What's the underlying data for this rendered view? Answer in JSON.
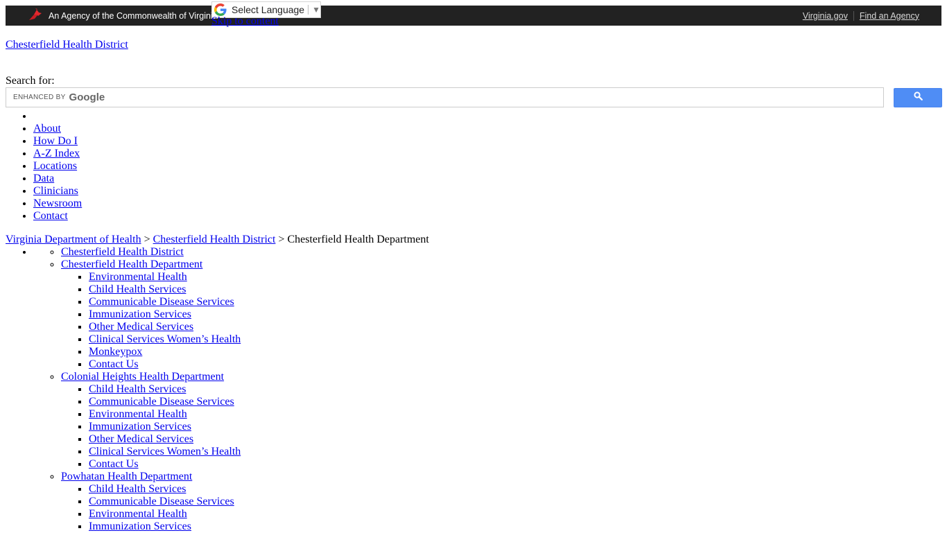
{
  "topbar": {
    "agency_text": "An Agency of the Commonwealth of Virginia",
    "links": [
      {
        "label": "Virginia.gov"
      },
      {
        "label": "Find an Agency"
      }
    ],
    "bg_color": "#222222",
    "logo_color": "#e5282e"
  },
  "translate": {
    "label": "Select Language",
    "arrow": "▼"
  },
  "skip_link": "Skip to content",
  "site_link": "Chesterfield Health District",
  "search": {
    "label": "Search for:",
    "enhanced_by": "ENHANCED BY",
    "google": "Google",
    "value": "",
    "button_color": "#4f8df5"
  },
  "nav": {
    "items": [
      {
        "label": ""
      },
      {
        "label": "About"
      },
      {
        "label": "How Do I"
      },
      {
        "label": "A-Z Index"
      },
      {
        "label": "Locations"
      },
      {
        "label": "Data"
      },
      {
        "label": "Clinicians"
      },
      {
        "label": "Newsroom"
      },
      {
        "label": "Contact"
      }
    ]
  },
  "breadcrumb": {
    "items": [
      {
        "label": "Virginia Department of Health"
      },
      {
        "label": "Chesterfield Health District"
      }
    ],
    "separator": ">",
    "current": "Chesterfield Health Department"
  },
  "tree": {
    "departments": [
      {
        "label": "Chesterfield Health District",
        "children": []
      },
      {
        "label": "Chesterfield Health Department",
        "children": [
          "Environmental Health",
          "Child Health Services",
          "Communicable Disease Services",
          "Immunization Services",
          "Other Medical Services",
          "Clinical Services Women’s Health",
          "Monkeypox",
          "Contact Us"
        ]
      },
      {
        "label": "Colonial Heights Health Department",
        "children": [
          "Child Health Services",
          "Communicable Disease Services",
          "Environmental Health",
          "Immunization Services",
          "Other Medical Services",
          "Clinical Services Women’s Health",
          "Contact Us"
        ]
      },
      {
        "label": "Powhatan Health Department",
        "children": [
          "Child Health Services",
          "Communicable Disease Services",
          "Environmental Health",
          "Immunization Services"
        ]
      }
    ]
  }
}
